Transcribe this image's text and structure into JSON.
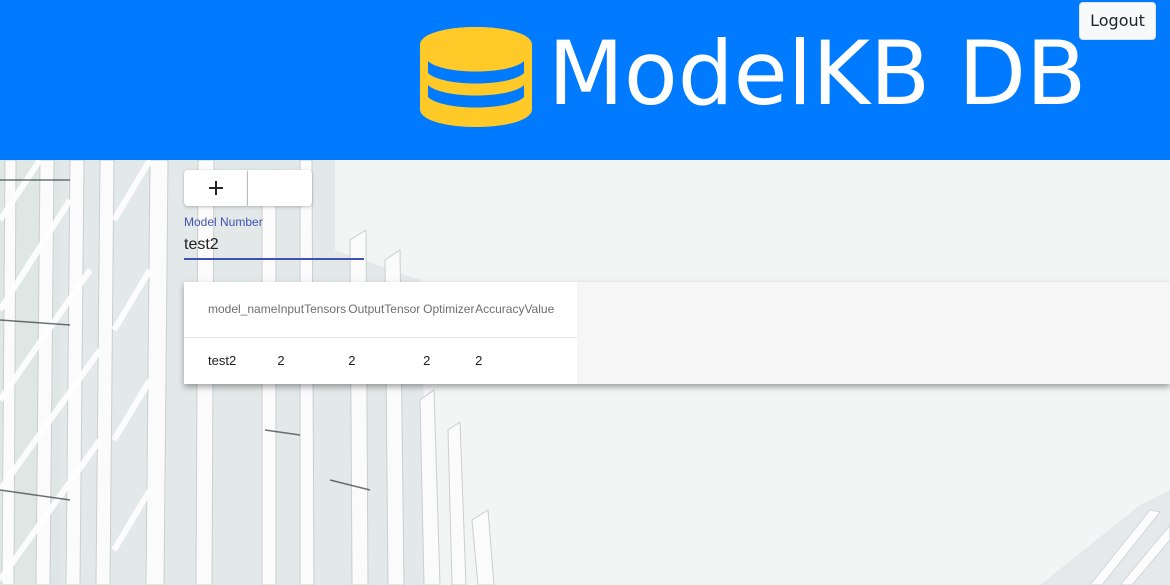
{
  "header": {
    "brand": "ModelKB DB",
    "logout_label": "Logout",
    "logo_icon": "database-icon",
    "background_color": "#007bff",
    "logo_color": "#ffca28"
  },
  "toolbar": {
    "add_icon": "plus-icon",
    "add_glyph": "+"
  },
  "model_field": {
    "label": "Model Number",
    "value": "test2",
    "accent_color": "#3f51b5"
  },
  "table": {
    "columns": [
      "model_name",
      "InputTensors",
      "OutputTensor",
      "Optimizer",
      "AccuracyValue"
    ],
    "rows": [
      [
        "test2",
        "2",
        "2",
        "2",
        "2"
      ]
    ]
  }
}
